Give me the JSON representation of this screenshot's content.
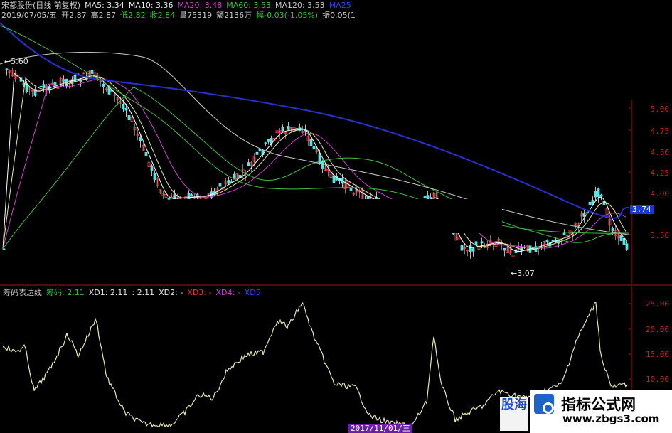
{
  "header": {
    "line1": [
      {
        "text": "宋都股份(日线 前复权)",
        "color": "#c8c8c8"
      },
      {
        "text": "MA5: 3.34",
        "color": "#e8e8e8"
      },
      {
        "text": "MA10: 3.36",
        "color": "#e8e8e8"
      },
      {
        "text": "MA20: 3.48",
        "color": "#d040d0"
      },
      {
        "text": "MA60: 3.53",
        "color": "#40c040"
      },
      {
        "text": "MA120: 3.53",
        "color": "#c8c8c8"
      },
      {
        "text": "MA25",
        "color": "#3040ff"
      }
    ],
    "line2": [
      {
        "text": "2019/07/05/五",
        "color": "#c8c8c8"
      },
      {
        "text": "开2.87",
        "color": "#c8c8c8"
      },
      {
        "text": "高2.87",
        "color": "#c8c8c8"
      },
      {
        "text": "低2.82",
        "color": "#30c030"
      },
      {
        "text": "收2.84",
        "color": "#30c030"
      },
      {
        "text": "量75319",
        "color": "#c8c8c8"
      },
      {
        "text": "额2136万",
        "color": "#c8c8c8"
      },
      {
        "text": "幅-0.03(-1.05%)",
        "color": "#30c030"
      },
      {
        "text": "振0.05(1",
        "color": "#c8c8c8"
      }
    ]
  },
  "price_axis": {
    "ticks": [
      "5.00",
      "4.75",
      "4.50",
      "4.25",
      "4.00",
      "3.50"
    ],
    "current_price": "3.74"
  },
  "price_labels": {
    "high_marker": "←5.60",
    "low_marker": "←3.07"
  },
  "indicator": {
    "name": "筹码表达线",
    "items": [
      {
        "text": "筹码: 2.11",
        "color": "#30c030"
      },
      {
        "text": "XD1: 2.11",
        "color": "#e8e8e8"
      },
      {
        "text": ": 2.11",
        "color": "#e8e8e8"
      },
      {
        "text": "XD2: -",
        "color": "#e8e8e8"
      },
      {
        "text": "XD3: -",
        "color": "#e03030"
      },
      {
        "text": "XD4: -",
        "color": "#d040d0"
      },
      {
        "text": "XD5",
        "color": "#3040ff"
      }
    ],
    "ticks": [
      "25.00",
      "20.00",
      "15.00",
      "10.00"
    ]
  },
  "date_badge": "2017/11/01/三",
  "watermark": {
    "logo_text": "股海",
    "title": "指标公式网",
    "url": "www.zbgs3.com"
  },
  "colors": {
    "axis_red": "#a01818",
    "ma5": "#ffffff",
    "ma10": "#e8e8a0",
    "ma20": "#d040d0",
    "ma60": "#40c040",
    "ma120": "#c8c8c8",
    "ma250": "#2830d0",
    "candle_up": "#ff4040",
    "candle_down": "#60e0e0",
    "indicator_line": "#e8e8b0"
  }
}
